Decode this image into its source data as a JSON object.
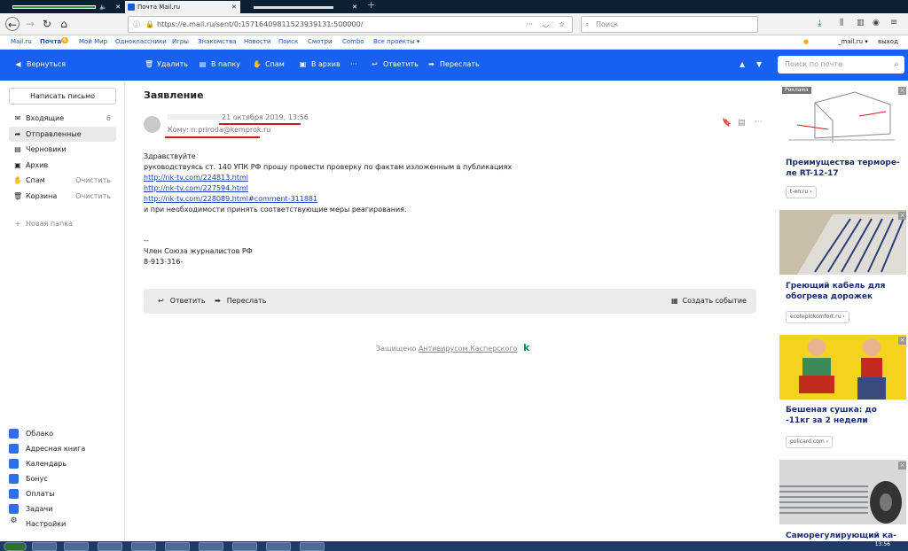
{
  "browser": {
    "tabs": [
      {
        "label": "",
        "close": "✕"
      },
      {
        "label": "Почта Mail.ru",
        "close": "✕"
      },
      {
        "label": "",
        "close": "✕"
      }
    ],
    "url": "https://e.mail.ru/sent/0:15716409811523939131:500000/",
    "search_placeholder": "Поиск"
  },
  "portal": {
    "links": [
      "Mail.ru",
      "Почта",
      "Мой Мир",
      "Одноклассники",
      "Игры",
      "Знакомства",
      "Новости",
      "Поиск",
      "Смотри",
      "Combo",
      "Все проекты ▾"
    ],
    "mail_badge": "6",
    "account": "_mail.ru ▾",
    "logout": "выход"
  },
  "toolbar": {
    "back": "Вернуться",
    "delete": "Удалить",
    "to_folder": "В папку",
    "spam": "Спам",
    "archive": "В архив",
    "more": "···",
    "reply": "Ответить",
    "forward": "Переслать",
    "mail_search_placeholder": "Поиск по почте"
  },
  "sidebar": {
    "compose": "Написать письмо",
    "folders": [
      {
        "label": "Входящие",
        "right": "6",
        "icon": "✉"
      },
      {
        "label": "Отправленные",
        "right": "",
        "icon": "➦"
      },
      {
        "label": "Черновики",
        "right": "",
        "icon": "▤"
      },
      {
        "label": "Архив",
        "right": "",
        "icon": "▣"
      },
      {
        "label": "Спам",
        "right": "Очистить",
        "icon": "✋"
      },
      {
        "label": "Корзина",
        "right": "Очистить",
        "icon": "🗑"
      }
    ],
    "new_folder": "Новая папка",
    "apps": [
      {
        "label": "Облако",
        "color": "#2f6fe0"
      },
      {
        "label": "Адресная книга",
        "color": "#2f6fe0"
      },
      {
        "label": "Календарь",
        "color": "#2f6fe0"
      },
      {
        "label": "Бонус",
        "color": "#2f6fe0"
      },
      {
        "label": "Оплаты",
        "color": "#2f6fe0"
      },
      {
        "label": "Задачи",
        "color": "#2f6fe0"
      },
      {
        "label": "Настройки",
        "color": "#ffffff"
      }
    ]
  },
  "message": {
    "subject": "Заявление",
    "date": "21 октября 2019, 13:56",
    "to": "Кому: n.priroda@kemprok.ru",
    "body": [
      "Здравствуйте",
      "руководствуясь ст. 140 УПК РФ прошу провести проверку по фактам изложенным в публикациях"
    ],
    "links": [
      "http://nk-tv.com/224813.html",
      "http://nk-tv.com/227594.html",
      "http://nk-tv.com/228089.html#comment-311881"
    ],
    "closing": "и при необходимости принять соответствующие меры реагирования.",
    "separator": "--",
    "signature": "Член Союза журналистов РФ",
    "phone": "8-913-316-",
    "reply": "Ответить",
    "forward": "Переслать",
    "create_event": "Создать событие",
    "protected_prefix": "Защищено",
    "protected_link": "Антивирусом Касперского",
    "kaspersky_logo": "k"
  },
  "ads": {
    "label": "Реклама",
    "close": "×",
    "cards": [
      {
        "title": "Преимущества терморе­ле RT-12-17",
        "source": "t-en.ru ›"
      },
      {
        "title": "Греющий кабель для обо­грева дорожек",
        "source": "ecoteplokomfort.ru ›"
      },
      {
        "title": "Бешеная сушка: до -11кг за 2 недели",
        "source": "policard.com ›"
      },
      {
        "title": "Саморегулирующий ка-",
        "source": ""
      }
    ]
  },
  "taskbar": {
    "clock": "13:56"
  },
  "colors": {
    "accent": "#1760f0",
    "underline": "#d4161c",
    "link": "#1a3fb8",
    "ad_title": "#1b2e73"
  }
}
